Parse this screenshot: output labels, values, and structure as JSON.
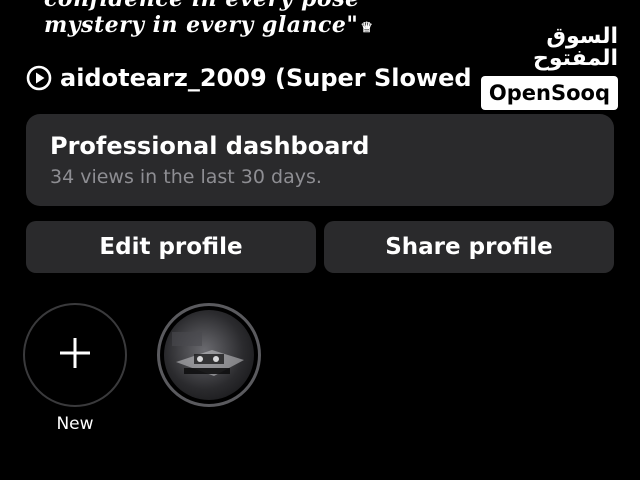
{
  "bio": {
    "line1": "confidence in every pose",
    "line2": "mystery in every glance\"",
    "crown_glyph": "♕"
  },
  "music": {
    "icon": "play-circle-icon",
    "track": "aidotearz_2009 (Super Slowed"
  },
  "watermark": {
    "arabic": "السوق المفتوح",
    "brand": "OpenSooq"
  },
  "dashboard": {
    "title": "Professional dashboard",
    "subtitle": "34 views in the last 30 days."
  },
  "actions": {
    "edit_label": "Edit profile",
    "share_label": "Share profile"
  },
  "highlights": {
    "new_label": "New",
    "new_icon": "plus-icon",
    "items": [
      {
        "icon": "highlight-thumbnail"
      }
    ]
  },
  "colors": {
    "background": "#000000",
    "card": "#2a2a2c",
    "muted_text": "#8e8e93"
  }
}
